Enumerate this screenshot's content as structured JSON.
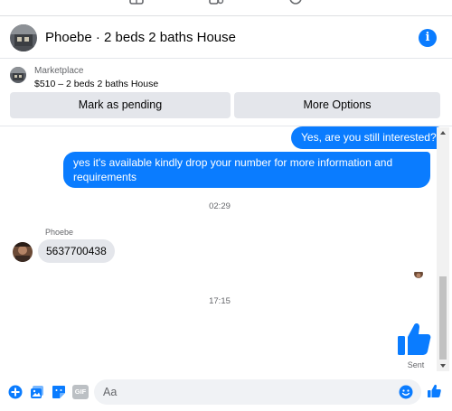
{
  "colors": {
    "accent": "#0a7cff",
    "bubble_in": "#e4e6eb",
    "muted_text": "#65676b"
  },
  "topbar": {
    "icons": [
      "marketplace-icon",
      "groups-icon",
      "profile-icon"
    ]
  },
  "header": {
    "title": "Phoebe · 2 beds 2 baths House",
    "info_icon": "info-icon"
  },
  "listing": {
    "category": "Marketplace",
    "summary": "$510 – 2 beds 2 baths House",
    "mark_pending_label": "Mark as pending",
    "more_options_label": "More Options"
  },
  "messages": {
    "outgoing_1": "Yes, are you still interested?",
    "outgoing_2": "yes it's available kindly drop your number for more information and requirements",
    "time_1": "02:29",
    "sender_name": "Phoebe",
    "incoming_1": "5637700438",
    "time_2": "17:15",
    "sent_status": "Sent"
  },
  "composer": {
    "placeholder": "Aa",
    "icons": [
      "add-icon",
      "photo-icon",
      "sticker-icon",
      "gif-icon",
      "emoji-icon",
      "like-icon"
    ],
    "gif_label": "GIF"
  }
}
